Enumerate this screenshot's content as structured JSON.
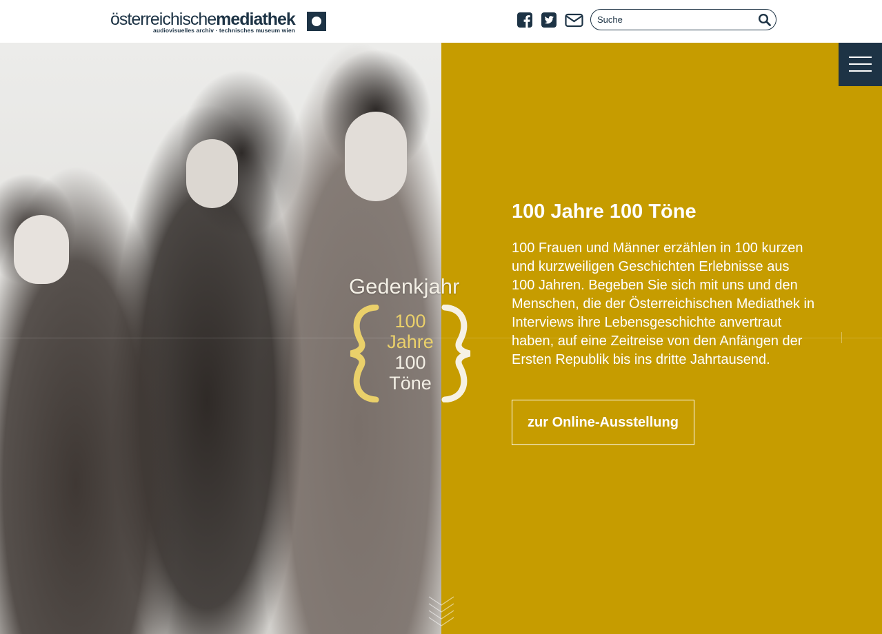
{
  "header": {
    "logo": {
      "main_light": "österreichische",
      "main_bold": "mediathek",
      "sub": "audiovisuelles archiv · technisches museum wien"
    },
    "social": [
      {
        "icon": "facebook-icon"
      },
      {
        "icon": "twitter-icon"
      },
      {
        "icon": "mail-icon"
      }
    ],
    "search": {
      "placeholder": "Suche",
      "icon": "search-icon"
    }
  },
  "menu": {
    "icon": "hamburger-menu-icon"
  },
  "hero": {
    "emblem": {
      "title": "Gedenkjahr",
      "line1": "100",
      "line2": "Jahre",
      "line3": "100",
      "line4": "Töne"
    },
    "headline": "100 Jahre 100 Töne",
    "body": "100 Frauen und Männer erzählen in 100 kurzen und kurzweiligen Geschichten Erlebnisse aus 100 Jahren. Begeben Sie sich mit uns und den Menschen, die der Österreichischen Mediathek in Interviews ihre Lebensgeschichte anvertraut haben, auf eine Zeitreise von den Anfängen der Ersten Republik bis ins dritte Jahrtausend.",
    "cta_label": "zur Online-Ausstellung"
  },
  "colors": {
    "brand_navy": "#1d3345",
    "gold": "#c69c00",
    "emblem_yellow": "#ead06a"
  }
}
